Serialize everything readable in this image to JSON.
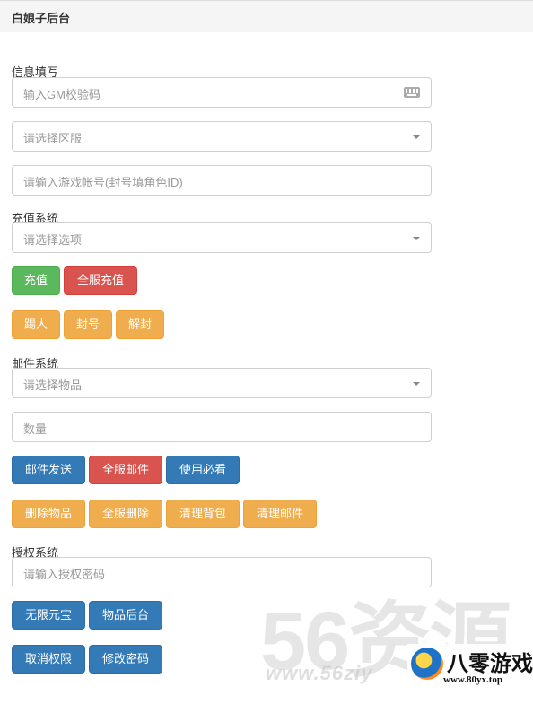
{
  "header": {
    "title": "白娘子后台"
  },
  "info_section": {
    "label": "信息填写",
    "gm_code_placeholder": "输入GM校验码",
    "server_select_placeholder": "请选择区服",
    "account_placeholder": "请输入游戏帐号(封号填角色ID)"
  },
  "recharge_section": {
    "label": "充值系统",
    "option_select_placeholder": "请选择选项",
    "buttons": {
      "recharge": "充值",
      "all_server_recharge": "全服充值"
    },
    "action_buttons": {
      "kick": "踢人",
      "ban": "封号",
      "unban": "解封"
    }
  },
  "mail_section": {
    "label": "邮件系统",
    "item_select_placeholder": "请选择物品",
    "quantity_placeholder": "数量",
    "buttons": {
      "send_mail": "邮件发送",
      "all_server_mail": "全服邮件",
      "usage_notice": "使用必看",
      "delete_item": "删除物品",
      "all_server_delete": "全服删除",
      "clear_bag": "清理背包",
      "clear_mail": "清理邮件"
    }
  },
  "auth_section": {
    "label": "授权系统",
    "auth_password_placeholder": "请输入授权密码",
    "buttons": {
      "unlimited_yuanbao": "无限元宝",
      "item_backend": "物品后台",
      "revoke_permission": "取消权限",
      "change_password": "修改密码"
    }
  },
  "watermark": {
    "big_text": "56资源",
    "url": "www.56ziy",
    "logo_text": "八零游戏",
    "logo_url": "www.80yx.top"
  },
  "colors": {
    "success": "#5cb85c",
    "danger": "#d9534f",
    "warning": "#f0ad4e",
    "primary": "#337ab7"
  }
}
